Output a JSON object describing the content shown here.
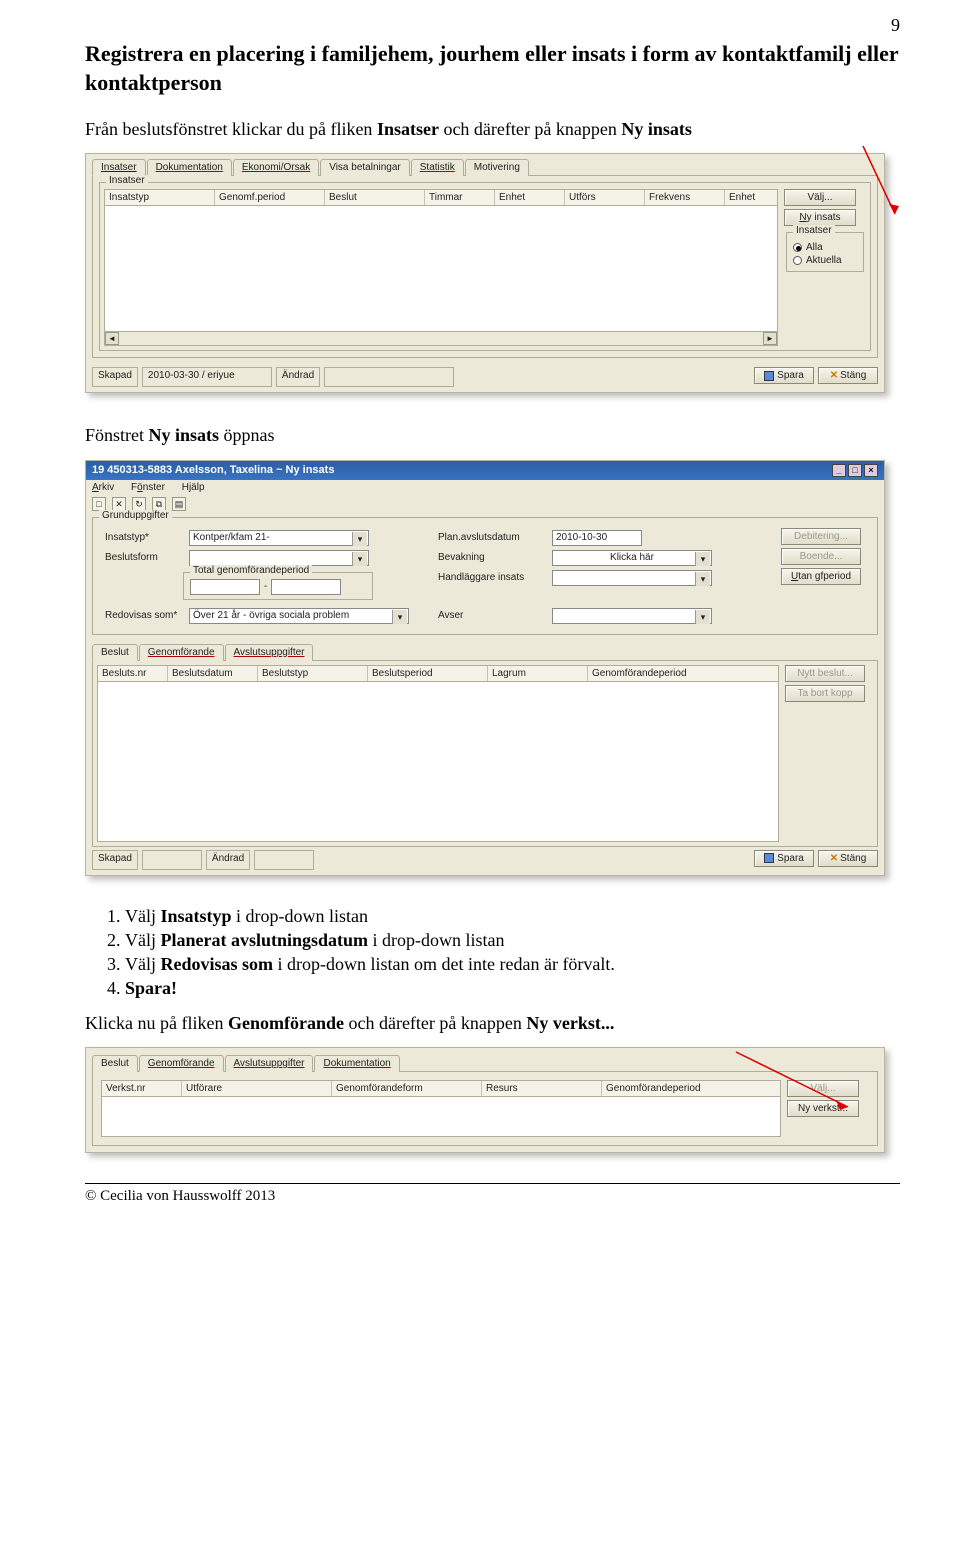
{
  "page_number": "9",
  "heading": "Registrera en placering i familjehem, jourhem eller insats i form av kontaktfamilj eller kontaktperson",
  "intro_prefix": "Från beslutsfönstret klickar du på fliken ",
  "intro_bold1": "Insatser",
  "intro_mid": " och därefter på knappen ",
  "intro_bold2": "Ny insats",
  "caption2_pre": "Fönstret ",
  "caption2_bold": "Ny insats",
  "caption2_post": " öppnas",
  "steps": {
    "s1_pre": "Välj ",
    "s1_b": "Insatstyp",
    "s1_post": " i drop-down listan",
    "s2_pre": "Välj ",
    "s2_b": "Planerat avslutningsdatum",
    "s2_post": " i drop-down listan",
    "s3_pre": "Välj ",
    "s3_b": "Redovisas som",
    "s3_post": " i drop-down listan om det inte redan är förvalt.",
    "s4_b": "Spara!"
  },
  "caption3_pre": "Klicka nu på fliken ",
  "caption3_b1": "Genomförande",
  "caption3_mid": " och därefter på knappen ",
  "caption3_b2": "Ny verkst...",
  "shot1": {
    "tabs": [
      "Insatser",
      "Dokumentation",
      "Ekonomi/Orsak",
      "Visa betalningar",
      "Statistik",
      "Motivering"
    ],
    "group_label": "Insatser",
    "cols": [
      "Insatstyp",
      "Genomf.period",
      "Beslut",
      "Timmar",
      "Enhet",
      "Utförs",
      "Frekvens",
      "Enhet"
    ],
    "btn_valj": "Välj...",
    "btn_ny": "Ny insats",
    "group_right": "Insatser",
    "radio_alla": "Alla",
    "radio_akt": "Aktuella",
    "status_skapad_lbl": "Skapad",
    "status_skapad_val": "2010-03-30 / eriyue",
    "status_andrad": "Ändrad",
    "btn_spara": "Spara",
    "btn_stang": "Stäng"
  },
  "shot2": {
    "title": "19 450313-5883  Axelsson, Taxelina   ~   Ny insats",
    "menu": [
      "Arkiv",
      "Fönster",
      "Hjälp"
    ],
    "group_label": "Grunduppgifter",
    "lbl_insatstyp": "Insatstyp*",
    "val_insatstyp": "Kontper/kfam 21-",
    "lbl_beslutsform": "Beslutsform",
    "lbl_totalperiod": "Total genomförandeperiod",
    "period_dash": "-",
    "lbl_redovisas": "Redovisas som*",
    "val_redovisas": "Över 21 år - övriga sociala problem",
    "lbl_plan": "Plan.avslutsdatum",
    "val_plan": "2010-10-30",
    "lbl_bevakning": "Bevakning",
    "val_bevakning": "Klicka här",
    "lbl_handl": "Handläggare insats",
    "lbl_avser": "Avser",
    "btn_deb": "Debitering...",
    "btn_boende": "Boende...",
    "btn_gfperiod": "Utan gfperiod",
    "tabs2": [
      "Beslut",
      "Genomförande",
      "Avslutsuppgifter"
    ],
    "cols2": [
      "Besluts.nr",
      "Beslutsdatum",
      "Beslutstyp",
      "Beslutsperiod",
      "Lagrum",
      "Genomförandeperiod"
    ],
    "btn_nytt": "Nytt beslut...",
    "btn_tabort": "Ta bort kopp",
    "status_skapad": "Skapad",
    "status_andrad": "Ändrad",
    "btn_spara": "Spara",
    "btn_stang": "Stäng"
  },
  "shot3": {
    "tabs": [
      "Beslut",
      "Genomförande",
      "Avslutsuppgifter",
      "Dokumentation"
    ],
    "cols": [
      "Verkst.nr",
      "Utförare",
      "Genomförandeform",
      "Resurs",
      "Genomförandeperiod"
    ],
    "btn_valj": "Välj...",
    "btn_ny": "Ny verkst..."
  },
  "footer": "© Cecilia von Hausswolff 2013"
}
